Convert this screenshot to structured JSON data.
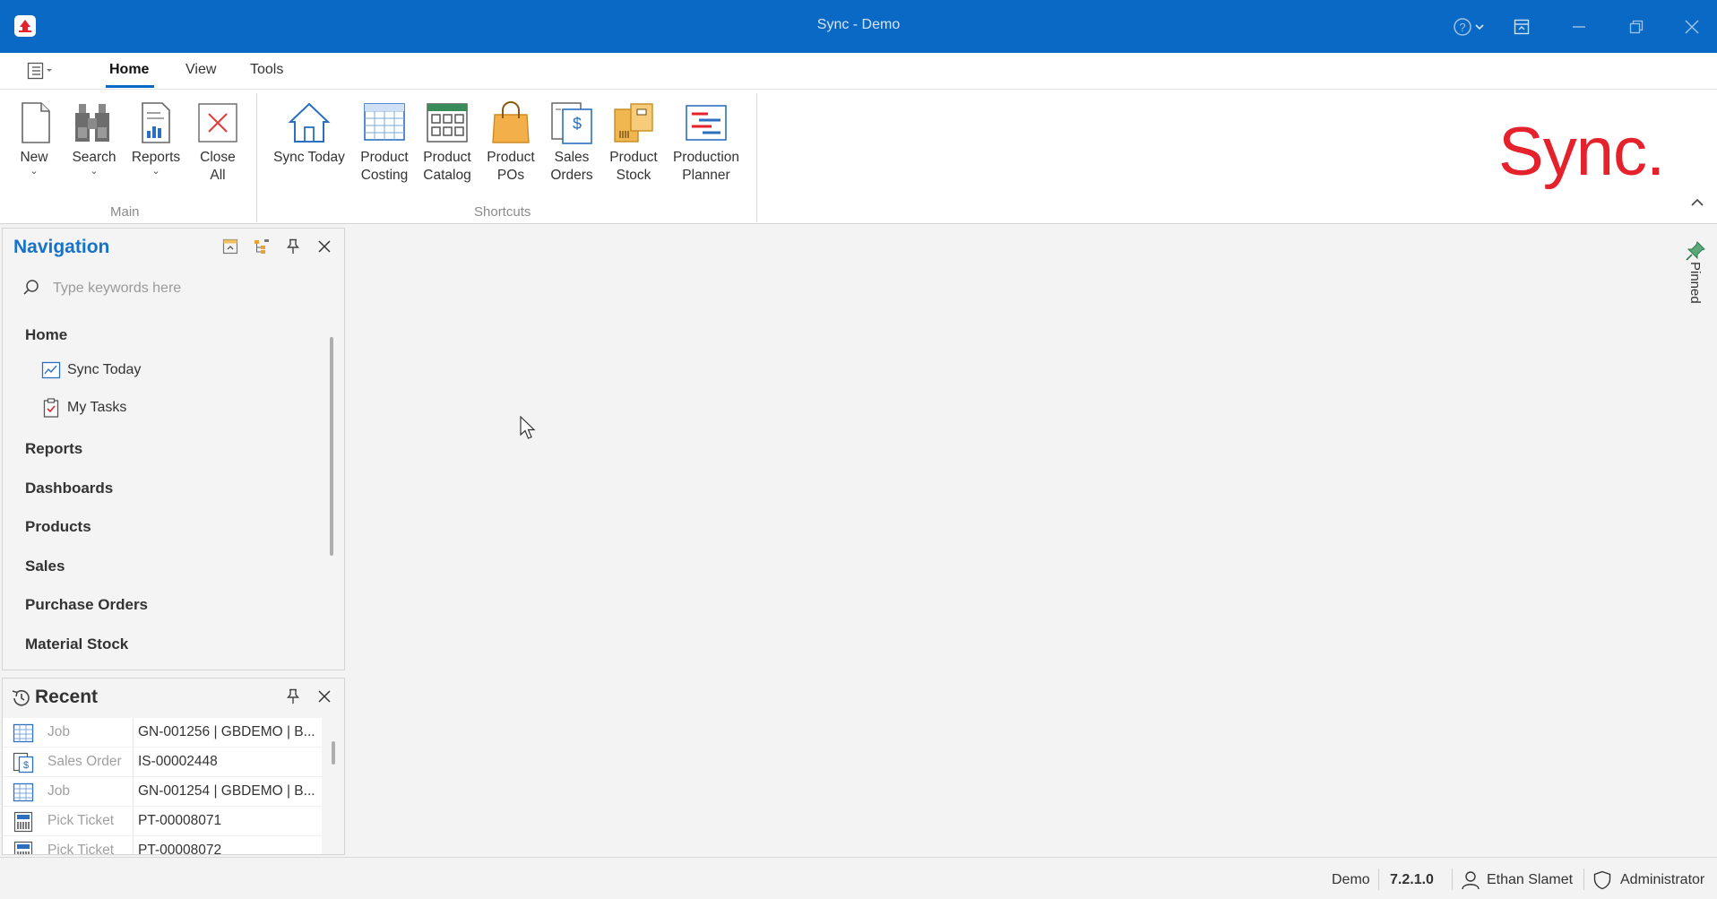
{
  "window": {
    "title": "Sync - Demo",
    "accent_color": "#0a69c4",
    "controls": [
      "help-icon",
      "ribbon-display-icon",
      "minimize-icon",
      "restore-icon",
      "close-icon"
    ]
  },
  "ribbon_tabs": {
    "file_menu_icon": "menu-icon",
    "tabs": [
      {
        "label": "Home",
        "active": true
      },
      {
        "label": "View",
        "active": false
      },
      {
        "label": "Tools",
        "active": false
      }
    ]
  },
  "ribbon": {
    "groups": {
      "main": "Main",
      "shortcuts": "Shortcuts"
    },
    "main_buttons": [
      {
        "label1": "New",
        "label2": "",
        "icon": "new-document-icon",
        "dropdown": true
      },
      {
        "label1": "Search",
        "label2": "",
        "icon": "binoculars-icon",
        "dropdown": true
      },
      {
        "label1": "Reports",
        "label2": "",
        "icon": "report-icon",
        "dropdown": true
      },
      {
        "label1": "Close",
        "label2": "All",
        "icon": "close-all-icon",
        "dropdown": false
      }
    ],
    "shortcut_buttons": [
      {
        "label1": "Sync Today",
        "label2": "",
        "icon": "home-icon"
      },
      {
        "label1": "Product",
        "label2": "Costing",
        "icon": "costing-grid-icon"
      },
      {
        "label1": "Product",
        "label2": "Catalog",
        "icon": "catalog-icon"
      },
      {
        "label1": "Product",
        "label2": "POs",
        "icon": "shopping-bag-icon"
      },
      {
        "label1": "Sales",
        "label2": "Orders",
        "icon": "sales-order-icon"
      },
      {
        "label1": "Product",
        "label2": "Stock",
        "icon": "stock-boxes-icon"
      },
      {
        "label1": "Production",
        "label2": "Planner",
        "icon": "planner-icon"
      }
    ],
    "brand": "Sync.",
    "brand_color": "#e5212c"
  },
  "navigation": {
    "title": "Navigation",
    "search_placeholder": "Type keywords here",
    "sections": {
      "home": "Home",
      "home_items": [
        {
          "label": "Sync Today",
          "icon": "chart-icon"
        },
        {
          "label": "My Tasks",
          "icon": "clipboard-check-icon"
        }
      ],
      "others": [
        "Reports",
        "Dashboards",
        "Products",
        "Sales",
        "Purchase Orders",
        "Material Stock"
      ]
    }
  },
  "recent": {
    "title": "Recent",
    "items": [
      {
        "type": "Job",
        "value": "GN-001256 | GBDEMO | B...",
        "icon": "job-grid-icon"
      },
      {
        "type": "Sales Order",
        "value": "IS-00002448",
        "icon": "sales-order-icon"
      },
      {
        "type": "Job",
        "value": "GN-001254 | GBDEMO | B...",
        "icon": "job-grid-icon"
      },
      {
        "type": "Pick Ticket",
        "value": "PT-00008071",
        "icon": "pick-ticket-icon"
      },
      {
        "type": "Pick Ticket",
        "value": "PT-00008072",
        "icon": "pick-ticket-icon"
      }
    ]
  },
  "pinned": {
    "label": "Pinned"
  },
  "statusbar": {
    "environment": "Demo",
    "version": "7.2.1.0",
    "user": "Ethan Slamet",
    "role": "Administrator"
  }
}
